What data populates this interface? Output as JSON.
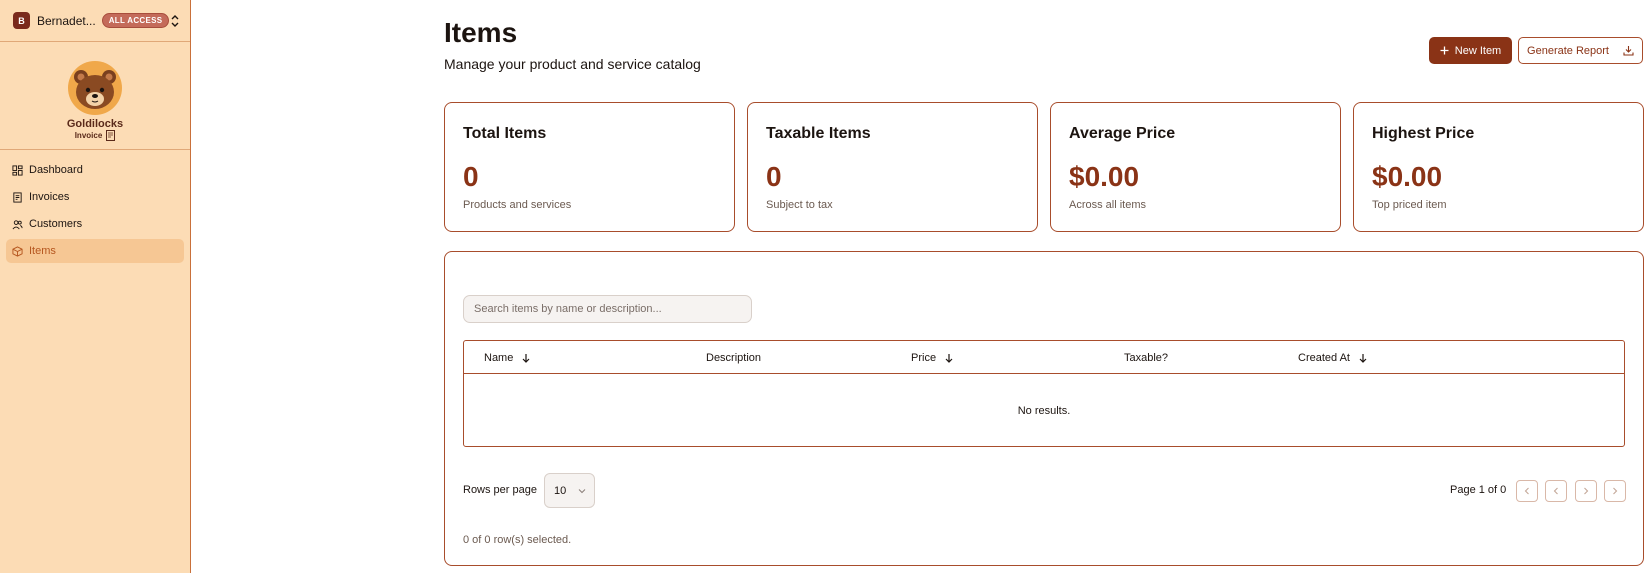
{
  "account": {
    "initial": "B",
    "name": "Bernadet...",
    "badge": "ALL ACCESS"
  },
  "logo": {
    "title": "Goldilocks",
    "subtitle": "Invoice"
  },
  "nav": [
    {
      "label": "Dashboard",
      "icon": "dashboard-icon"
    },
    {
      "label": "Invoices",
      "icon": "invoice-icon"
    },
    {
      "label": "Customers",
      "icon": "users-icon"
    },
    {
      "label": "Items",
      "icon": "package-icon",
      "active": true
    }
  ],
  "header": {
    "title": "Items",
    "subtitle": "Manage your product and service catalog",
    "new_item_label": "New Item",
    "report_label": "Generate Report"
  },
  "stats": [
    {
      "title": "Total Items",
      "value": "0",
      "desc": "Products and services"
    },
    {
      "title": "Taxable Items",
      "value": "0",
      "desc": "Subject to tax"
    },
    {
      "title": "Average Price",
      "value": "$0.00",
      "desc": "Across all items"
    },
    {
      "title": "Highest Price",
      "value": "$0.00",
      "desc": "Top priced item"
    }
  ],
  "search": {
    "placeholder": "Search items by name or description..."
  },
  "table": {
    "columns": [
      {
        "label": "Name",
        "sortable": true
      },
      {
        "label": "Description",
        "sortable": false
      },
      {
        "label": "Price",
        "sortable": true
      },
      {
        "label": "Taxable?",
        "sortable": false
      },
      {
        "label": "Created At",
        "sortable": true
      }
    ],
    "empty_text": "No results."
  },
  "pagination": {
    "rows_label": "Rows per page",
    "rows_value": "10",
    "page_info": "Page 1 of 0",
    "selected_info": "0 of 0 row(s) selected."
  },
  "colors": {
    "accent": "#8a3316",
    "sidebar_bg": "#fcdcb5",
    "border": "#a84d2c"
  }
}
